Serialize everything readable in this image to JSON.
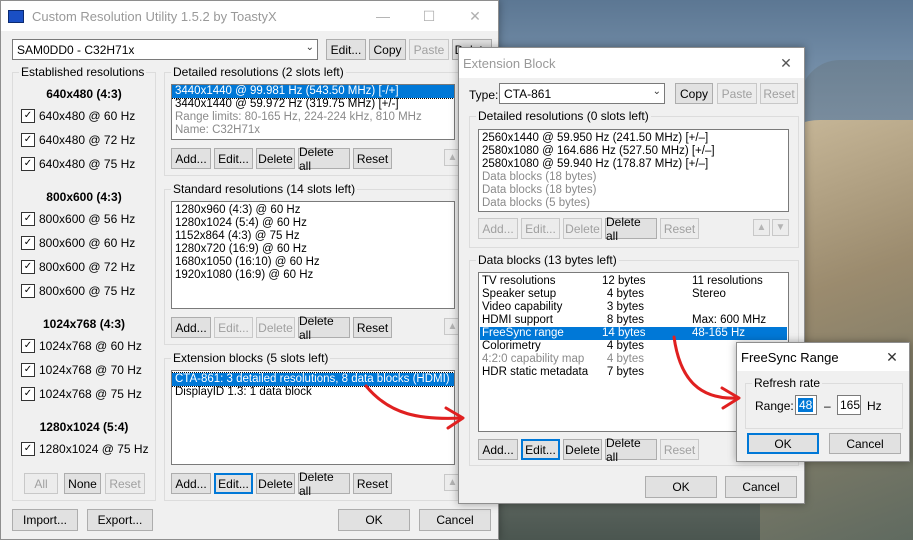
{
  "main": {
    "title": "Custom Resolution Utility 1.5.2 by ToastyX",
    "monitor_select": "SAM0DD0 - C32H71x",
    "top_buttons": {
      "edit": "Edit...",
      "copy": "Copy",
      "paste": "Paste",
      "delete": "Delete"
    },
    "established": {
      "label": "Established resolutions",
      "groups": [
        {
          "heading": "640x480 (4:3)",
          "items": [
            "640x480 @ 60 Hz",
            "640x480 @ 72 Hz",
            "640x480 @ 75 Hz"
          ]
        },
        {
          "heading": "800x600 (4:3)",
          "items": [
            "800x600 @ 56 Hz",
            "800x600 @ 60 Hz",
            "800x600 @ 72 Hz",
            "800x600 @ 75 Hz"
          ]
        },
        {
          "heading": "1024x768 (4:3)",
          "items": [
            "1024x768 @ 60 Hz",
            "1024x768 @ 70 Hz",
            "1024x768 @ 75 Hz"
          ]
        },
        {
          "heading": "1280x1024 (5:4)",
          "items": [
            "1280x1024 @ 75 Hz"
          ]
        }
      ],
      "buttons": {
        "all": "All",
        "none": "None",
        "reset": "Reset"
      }
    },
    "detailed": {
      "label": "Detailed resolutions (2 slots left)",
      "items": [
        "3440x1440 @ 99.981 Hz (543.50 MHz) [-/+]",
        "3440x1440 @ 59.972 Hz (319.75 MHz) [+/-]",
        "Range limits: 80-165 Hz, 224-224 kHz, 810 MHz",
        "Name: C32H71x"
      ]
    },
    "standard": {
      "label": "Standard resolutions (14 slots left)",
      "items": [
        "1280x960 (4:3) @ 60 Hz",
        "1280x1024 (5:4) @ 60 Hz",
        "1152x864 (4:3) @ 75 Hz",
        "1280x720 (16:9) @ 60 Hz",
        "1680x1050 (16:10) @ 60 Hz",
        "1920x1080 (16:9) @ 60 Hz"
      ]
    },
    "extension": {
      "label": "Extension blocks (5 slots left)",
      "items": [
        "CTA-861: 3 detailed resolutions, 8 data blocks (HDMI)",
        "DisplayID 1.3: 1 data block"
      ]
    },
    "list_buttons": {
      "add": "Add...",
      "edit": "Edit...",
      "delete": "Delete",
      "delete_all": "Delete all",
      "reset": "Reset"
    },
    "bottom": {
      "import": "Import...",
      "export": "Export...",
      "ok": "OK",
      "cancel": "Cancel"
    }
  },
  "ext": {
    "title": "Extension Block",
    "type_label": "Type:",
    "type_value": "CTA-861",
    "buttons": {
      "copy": "Copy",
      "paste": "Paste",
      "reset": "Reset"
    },
    "detailed": {
      "label": "Detailed resolutions (0 slots left)",
      "items": [
        "2560x1440 @ 59.950 Hz (241.50 MHz) [+/–]",
        "2580x1080 @ 164.686 Hz (527.50 MHz) [+/–]",
        "2580x1080 @ 59.940 Hz (178.87 MHz) [+/–]",
        "Data blocks (18 bytes)",
        "Data blocks (18 bytes)",
        "Data blocks (5 bytes)"
      ]
    },
    "datablocks": {
      "label": "Data blocks (13 bytes left)",
      "rows": [
        {
          "name": "TV resolutions",
          "size": "12 bytes",
          "info": "11 resolutions"
        },
        {
          "name": "Speaker setup",
          "size": "4 bytes",
          "info": "Stereo"
        },
        {
          "name": "Video capability",
          "size": "3 bytes",
          "info": ""
        },
        {
          "name": "HDMI support",
          "size": "8 bytes",
          "info": "Max: 600 MHz"
        },
        {
          "name": "FreeSync range",
          "size": "14 bytes",
          "info": "48-165 Hz"
        },
        {
          "name": "Colorimetry",
          "size": "4 bytes",
          "info": ""
        },
        {
          "name": "4:2:0 capability map",
          "size": "4 bytes",
          "info": ""
        },
        {
          "name": "HDR static metadata",
          "size": "7 bytes",
          "info": ""
        }
      ]
    },
    "list_buttons": {
      "add": "Add...",
      "edit": "Edit...",
      "delete": "Delete",
      "delete_all": "Delete all",
      "reset": "Reset"
    },
    "ok": "OK",
    "cancel": "Cancel"
  },
  "freesync": {
    "title": "FreeSync Range",
    "group_label": "Refresh rate",
    "range_label": "Range:",
    "min": "48",
    "dash": "–",
    "max": "165",
    "unit": "Hz",
    "ok": "OK",
    "cancel": "Cancel"
  },
  "colors": {
    "accent": "#0078d7",
    "annotation_arrow": "#e02020"
  }
}
